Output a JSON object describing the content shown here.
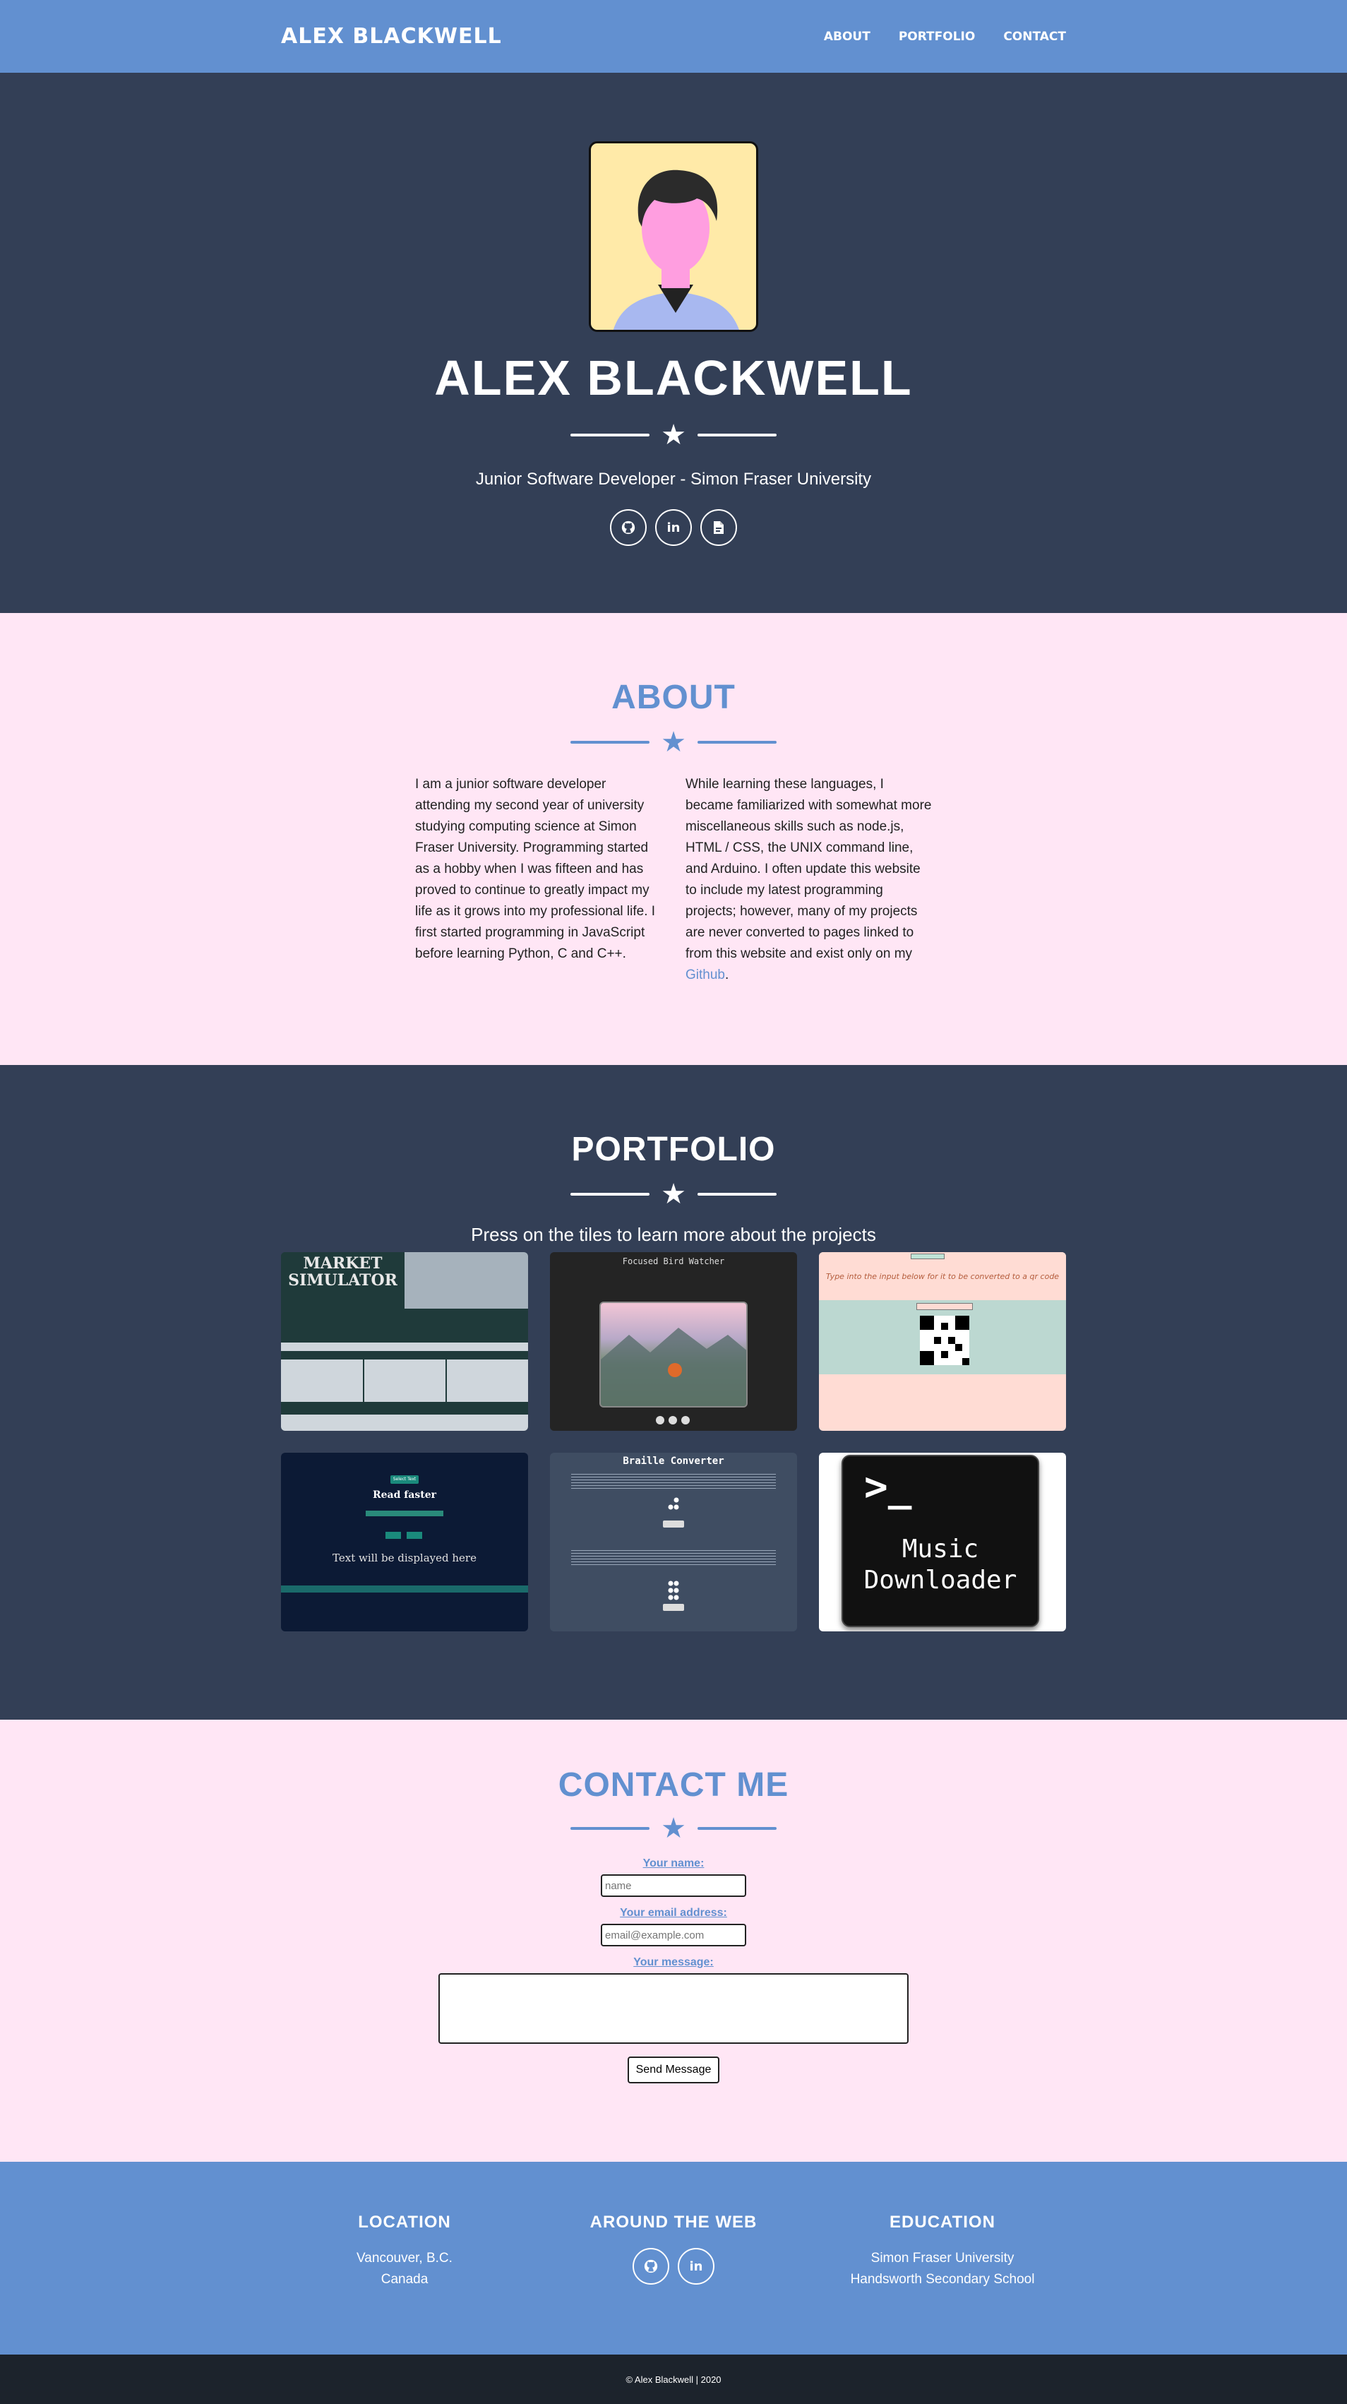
{
  "nav": {
    "brand": "ALEX BLACKWELL",
    "links": [
      "ABOUT",
      "PORTFOLIO",
      "CONTACT"
    ]
  },
  "hero": {
    "title": "ALEX BLACKWELL",
    "subtitle": "Junior Software Developer - Simon Fraser University",
    "social_icons": [
      "github-icon",
      "linkedin-icon",
      "resume-pdf-icon"
    ]
  },
  "about": {
    "title": "ABOUT",
    "col1": "I am a junior software developer attending my second year of university studying computing science at Simon Fraser University. Programming started as a hobby when I was fifteen and has proved to continue to greatly impact my life as it grows into my professional life. I first started programming in JavaScript before learning Python, C and C++.",
    "col2_text": "While learning these languages, I became familiarized with somewhat more miscellaneous skills such as node.js, HTML / CSS, the UNIX command line, and Arduino. I often update this website to include my latest programming projects; however, many of my projects are never converted to pages linked to from this website and exist only on my ",
    "col2_link": "Github",
    "col2_end": "."
  },
  "portfolio": {
    "title": "PORTFOLIO",
    "subtitle": "Press on the tiles to learn more about the projects",
    "tiles": {
      "market": {
        "title_line1": "MARKET",
        "title_line2": "SIMULATOR"
      },
      "bird": {
        "title": "Focused Bird Watcher"
      },
      "qr": {
        "text": "Type into the input below for it to be converted to a qr code"
      },
      "read": {
        "button": "Select Text",
        "heading": "Read faster",
        "display": "Text will be displayed here"
      },
      "braille": {
        "title": "Braille Converter"
      },
      "music": {
        "prompt": ">_",
        "line1": "Music",
        "line2": "Downloader"
      }
    }
  },
  "contact": {
    "title": "CONTACT ME",
    "name_label": "Your name:",
    "name_placeholder": "name",
    "email_label": "Your email address:",
    "email_placeholder": "email@example.com",
    "message_label": "Your message:",
    "send": "Send Message"
  },
  "footer": {
    "location": {
      "title": "LOCATION",
      "line1": "Vancouver, B.C.",
      "line2": "Canada"
    },
    "web": {
      "title": "AROUND THE WEB"
    },
    "education": {
      "title": "EDUCATION",
      "line1": "Simon Fraser University",
      "line2": "Handsworth Secondary School"
    },
    "copyright": "© Alex Blackwell | 2020"
  },
  "colors": {
    "accent": "#6290d0",
    "dark": "#333f56",
    "pink": "#ffe6f5",
    "footer_bottom": "#1c232c"
  }
}
